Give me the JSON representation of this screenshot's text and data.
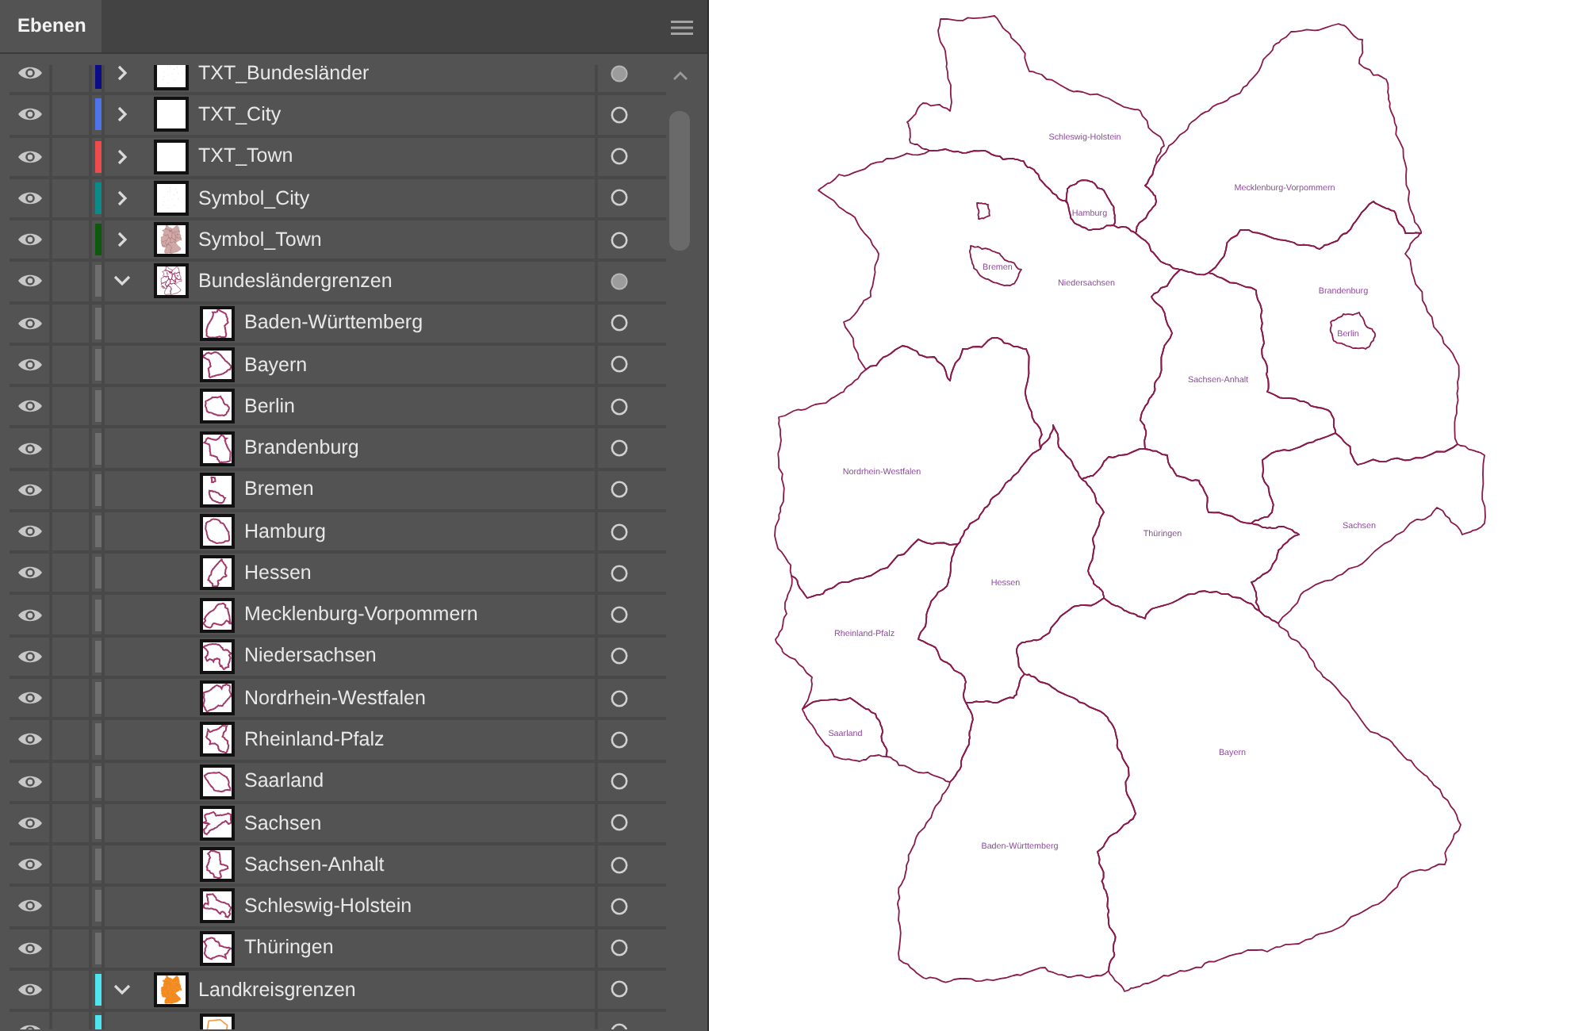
{
  "panel": {
    "tab": "Ebenen",
    "layers": [
      {
        "name": "TXT_Bundesländer",
        "visible": true,
        "color": "#0c0c86",
        "expanded": false,
        "kind": "dots",
        "has_appearance": true
      },
      {
        "name": "TXT_City",
        "visible": true,
        "color": "#4f73e8",
        "expanded": false,
        "kind": "blank",
        "has_appearance": false
      },
      {
        "name": "TXT_Town",
        "visible": true,
        "color": "#ee4c4c",
        "expanded": false,
        "kind": "blank",
        "has_appearance": false
      },
      {
        "name": "Symbol_City",
        "visible": true,
        "color": "#0b8a8a",
        "expanded": false,
        "kind": "dots",
        "has_appearance": false
      },
      {
        "name": "Symbol_Town",
        "visible": true,
        "color": "#0d5a0d",
        "expanded": false,
        "kind": "texture",
        "has_appearance": false
      },
      {
        "name": "Bundesländergrenzen",
        "visible": true,
        "color": "#6e6e6e",
        "expanded": true,
        "kind": "borders",
        "has_appearance": true,
        "children": [
          {
            "name": "Baden-Württemberg",
            "visible": true,
            "kind": "outline",
            "has_appearance": false
          },
          {
            "name": "Bayern",
            "visible": true,
            "kind": "outline",
            "has_appearance": false
          },
          {
            "name": "Berlin",
            "visible": true,
            "kind": "outline",
            "has_appearance": false
          },
          {
            "name": "Brandenburg",
            "visible": true,
            "kind": "outline",
            "has_appearance": false
          },
          {
            "name": "Bremen",
            "visible": true,
            "kind": "outline",
            "has_appearance": false
          },
          {
            "name": "Hamburg",
            "visible": true,
            "kind": "outline",
            "has_appearance": false
          },
          {
            "name": "Hessen",
            "visible": true,
            "kind": "outline",
            "has_appearance": false
          },
          {
            "name": "Mecklenburg-Vorpommern",
            "visible": true,
            "kind": "outline",
            "has_appearance": false
          },
          {
            "name": "Niedersachsen",
            "visible": true,
            "kind": "outline",
            "has_appearance": false
          },
          {
            "name": "Nordrhein-Westfalen",
            "visible": true,
            "kind": "outline",
            "has_appearance": false
          },
          {
            "name": "Rheinland-Pfalz",
            "visible": true,
            "kind": "outline",
            "has_appearance": false
          },
          {
            "name": "Saarland",
            "visible": true,
            "kind": "outline",
            "has_appearance": false
          },
          {
            "name": "Sachsen",
            "visible": true,
            "kind": "outline",
            "has_appearance": false
          },
          {
            "name": "Sachsen-Anhalt",
            "visible": true,
            "kind": "outline",
            "has_appearance": false
          },
          {
            "name": "Schleswig-Holstein",
            "visible": true,
            "kind": "outline",
            "has_appearance": false
          },
          {
            "name": "Thüringen",
            "visible": true,
            "kind": "outline",
            "has_appearance": false
          }
        ]
      },
      {
        "name": "Landkreisgrenzen",
        "visible": true,
        "color": "#4ee6ee",
        "expanded": true,
        "kind": "fill",
        "has_appearance": false,
        "children": [
          {
            "visible": true,
            "kind": "district",
            "has_appearance": false
          }
        ]
      }
    ]
  },
  "map": {
    "labels": [
      "Schleswig-Holstein",
      "Mecklenburg-Vorpommern",
      "Hamburg",
      "Bremen",
      "Niedersachsen",
      "Brandenburg",
      "Berlin",
      "Sachsen-Anhalt",
      "Nordrhein-Westfalen",
      "Sachsen",
      "Thüringen",
      "Hessen",
      "Rheinland-Pfalz",
      "Saarland",
      "Bayern",
      "Baden-Württemberg"
    ]
  }
}
